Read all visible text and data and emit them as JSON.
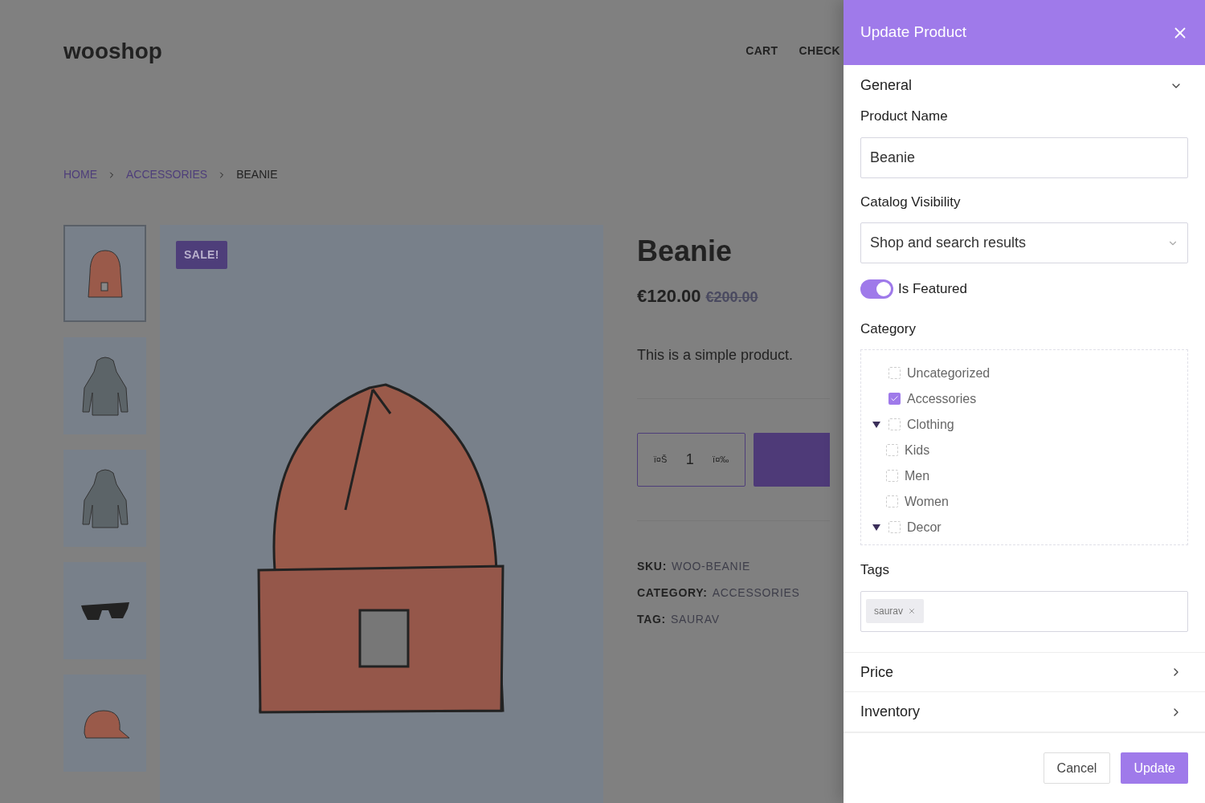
{
  "site": {
    "logo": "wooshop",
    "nav": [
      "CART",
      "CHECK"
    ]
  },
  "breadcrumb": [
    {
      "label": "HOME",
      "link": true
    },
    {
      "label": "ACCESSORIES",
      "link": true
    },
    {
      "label": "BEANIE",
      "link": false
    }
  ],
  "gallery": {
    "thumbnails": [
      {
        "kind": "beanie",
        "selected": true
      },
      {
        "kind": "hoodie",
        "selected": false
      },
      {
        "kind": "hoodie",
        "selected": false
      },
      {
        "kind": "sunglasses",
        "selected": false
      },
      {
        "kind": "cap",
        "selected": false
      }
    ],
    "badge": "SALE!"
  },
  "product": {
    "title": "Beanie",
    "price": "€120.00",
    "old_price": "€200.00",
    "description": "This is a simple product.",
    "quantity": {
      "minus": "ï¤Š",
      "value": "1",
      "plus": "ï¤‰"
    },
    "meta": [
      {
        "label": "SKU:",
        "value": "WOO-BEANIE"
      },
      {
        "label": "CATEGORY:",
        "value": "ACCESSORIES"
      },
      {
        "label": "TAG:",
        "value": "SAURAV"
      }
    ]
  },
  "panel": {
    "title": "Update Product",
    "general": {
      "title": "General",
      "expanded": true,
      "product_name_label": "Product Name",
      "product_name": "Beanie",
      "visibility_label": "Catalog Visibility",
      "visibility": "Shop and search results",
      "featured": {
        "label": "Is Featured",
        "on": true
      },
      "category_label": "Category",
      "categories": [
        {
          "label": "Uncategorized",
          "checked": false
        },
        {
          "label": "Accessories",
          "checked": true
        },
        {
          "label": "Clothing",
          "checked": false,
          "expanded": true,
          "children": [
            {
              "label": "Kids",
              "checked": false
            },
            {
              "label": "Men",
              "checked": false
            },
            {
              "label": "Women",
              "checked": false
            }
          ]
        },
        {
          "label": "Decor",
          "checked": false,
          "expanded": true
        }
      ],
      "tags_label": "Tags",
      "tags": [
        "saurav"
      ]
    },
    "sections": [
      {
        "title": "Price",
        "expanded": false
      },
      {
        "title": "Inventory",
        "expanded": false
      }
    ],
    "buttons": {
      "cancel": "Cancel",
      "update": "Update"
    }
  }
}
